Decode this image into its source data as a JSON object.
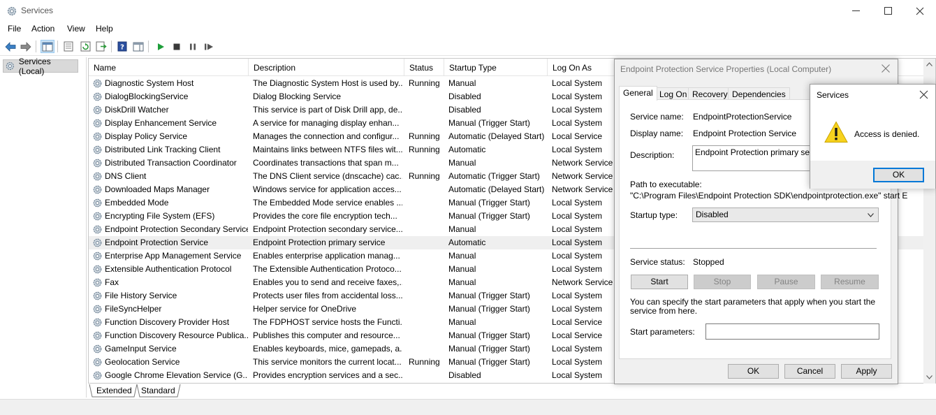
{
  "window": {
    "title": "Services",
    "icon": "gear-icon"
  },
  "menu": [
    "File",
    "Action",
    "View",
    "Help"
  ],
  "toolbar": {
    "icons": [
      "back-arrow-icon",
      "forward-arrow-icon",
      "show-hide-tree-icon",
      "properties-icon",
      "refresh-icon",
      "export-list-icon",
      "help-icon",
      "show-hide-action-pane-icon",
      "start-service-icon",
      "stop-service-icon",
      "pause-service-icon",
      "resume-service-icon"
    ]
  },
  "tree": {
    "label": "Services (Local)"
  },
  "columns": {
    "name": "Name",
    "description": "Description",
    "status": "Status",
    "startup": "Startup Type",
    "logon": "Log On As"
  },
  "services": [
    {
      "name": "Diagnostic System Host",
      "desc": "The Diagnostic System Host is used by...",
      "status": "Running",
      "startup": "Manual",
      "logon": "Local System"
    },
    {
      "name": "DialogBlockingService",
      "desc": "Dialog Blocking Service",
      "status": "",
      "startup": "Disabled",
      "logon": "Local System"
    },
    {
      "name": "DiskDrill Watcher",
      "desc": "This service is part of Disk Drill app, de...",
      "status": "",
      "startup": "Disabled",
      "logon": "Local System"
    },
    {
      "name": "Display Enhancement Service",
      "desc": "A service for managing display enhan...",
      "status": "",
      "startup": "Manual (Trigger Start)",
      "logon": "Local System"
    },
    {
      "name": "Display Policy Service",
      "desc": "Manages the connection and configur...",
      "status": "Running",
      "startup": "Automatic (Delayed Start)",
      "logon": "Local Service"
    },
    {
      "name": "Distributed Link Tracking Client",
      "desc": "Maintains links between NTFS files wit...",
      "status": "Running",
      "startup": "Automatic",
      "logon": "Local System"
    },
    {
      "name": "Distributed Transaction Coordinator",
      "desc": "Coordinates transactions that span m...",
      "status": "",
      "startup": "Manual",
      "logon": "Network Service"
    },
    {
      "name": "DNS Client",
      "desc": "The DNS Client service (dnscache) cac...",
      "status": "Running",
      "startup": "Automatic (Trigger Start)",
      "logon": "Network Service"
    },
    {
      "name": "Downloaded Maps Manager",
      "desc": "Windows service for application acces...",
      "status": "",
      "startup": "Automatic (Delayed Start)",
      "logon": "Network Service"
    },
    {
      "name": "Embedded Mode",
      "desc": "The Embedded Mode service enables ...",
      "status": "",
      "startup": "Manual (Trigger Start)",
      "logon": "Local System"
    },
    {
      "name": "Encrypting File System (EFS)",
      "desc": "Provides the core file encryption tech...",
      "status": "",
      "startup": "Manual (Trigger Start)",
      "logon": "Local System"
    },
    {
      "name": "Endpoint Protection Secondary Service",
      "desc": "Endpoint Protection secondary service...",
      "status": "",
      "startup": "Manual",
      "logon": "Local System"
    },
    {
      "name": "Endpoint Protection Service",
      "desc": "Endpoint Protection primary service",
      "status": "",
      "startup": "Automatic",
      "logon": "Local System"
    },
    {
      "name": "Enterprise App Management Service",
      "desc": "Enables enterprise application manag...",
      "status": "",
      "startup": "Manual",
      "logon": "Local System"
    },
    {
      "name": "Extensible Authentication Protocol",
      "desc": "The Extensible Authentication Protoco...",
      "status": "",
      "startup": "Manual",
      "logon": "Local System"
    },
    {
      "name": "Fax",
      "desc": "Enables you to send and receive faxes,...",
      "status": "",
      "startup": "Manual",
      "logon": "Network Service"
    },
    {
      "name": "File History Service",
      "desc": "Protects user files from accidental loss...",
      "status": "",
      "startup": "Manual (Trigger Start)",
      "logon": "Local System"
    },
    {
      "name": "FileSyncHelper",
      "desc": "Helper service for OneDrive",
      "status": "",
      "startup": "Manual (Trigger Start)",
      "logon": "Local System"
    },
    {
      "name": "Function Discovery Provider Host",
      "desc": "The FDPHOST service hosts the Functi...",
      "status": "",
      "startup": "Manual",
      "logon": "Local Service"
    },
    {
      "name": "Function Discovery Resource Publica...",
      "desc": "Publishes this computer and resource...",
      "status": "",
      "startup": "Manual (Trigger Start)",
      "logon": "Local Service"
    },
    {
      "name": "GameInput Service",
      "desc": "Enables keyboards, mice, gamepads, a...",
      "status": "",
      "startup": "Manual (Trigger Start)",
      "logon": "Local System"
    },
    {
      "name": "Geolocation Service",
      "desc": "This service monitors the current locat...",
      "status": "Running",
      "startup": "Manual (Trigger Start)",
      "logon": "Local System"
    },
    {
      "name": "Google Chrome Elevation Service (G...",
      "desc": "Provides encryption services and a sec...",
      "status": "",
      "startup": "Disabled",
      "logon": "Local System"
    }
  ],
  "bottom_tabs": [
    "Extended",
    "Standard"
  ],
  "properties": {
    "title": "Endpoint Protection Service Properties (Local Computer)",
    "tabs": [
      "General",
      "Log On",
      "Recovery",
      "Dependencies"
    ],
    "service_name_label": "Service name:",
    "service_name": "EndpointProtectionService",
    "display_name_label": "Display name:",
    "display_name": "Endpoint Protection Service",
    "description_label": "Description:",
    "description": "Endpoint Protection primary service",
    "path_label": "Path to executable:",
    "path": "\"C:\\Program Files\\Endpoint Protection SDK\\endpointprotection.exe\" start E",
    "startup_type_label": "Startup type:",
    "startup_type": "Disabled",
    "service_status_label": "Service status:",
    "service_status": "Stopped",
    "start": "Start",
    "stop": "Stop",
    "pause": "Pause",
    "resume": "Resume",
    "help_text": "You can specify the start parameters that apply when you start the service from here.",
    "start_params_label": "Start parameters:",
    "start_params_value": "",
    "ok": "OK",
    "cancel": "Cancel",
    "apply": "Apply"
  },
  "msgbox": {
    "title": "Services",
    "message": "Access is denied.",
    "ok": "OK",
    "icon": "warning-icon"
  }
}
